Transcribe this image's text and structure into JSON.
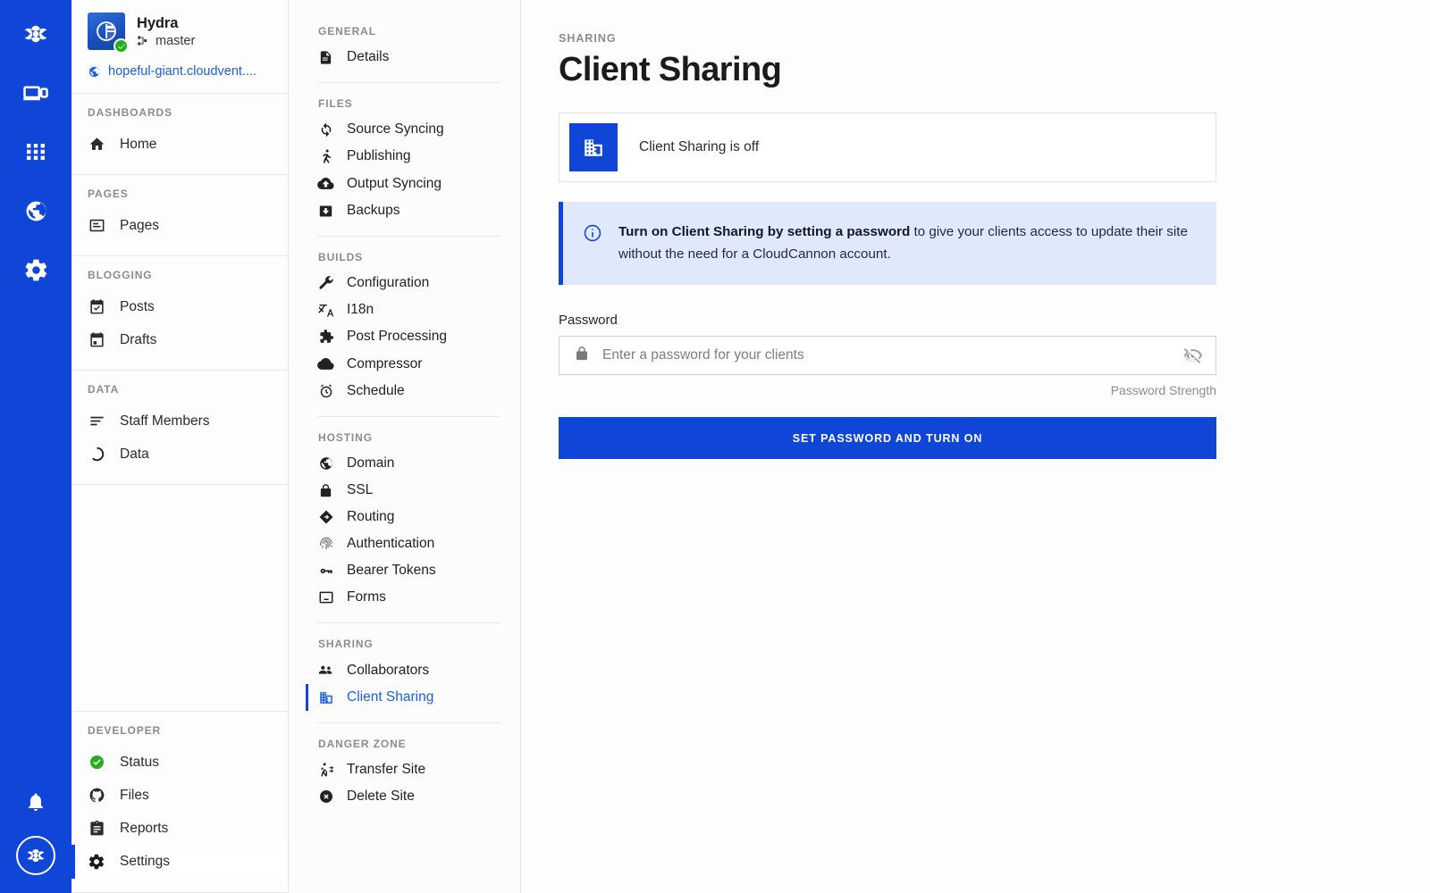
{
  "rail": {
    "top_icons": [
      {
        "name": "cloudcannon-logo-icon",
        "label": "CloudCannon"
      },
      {
        "name": "preview-device-icon",
        "label": "Preview"
      },
      {
        "name": "apps-grid-icon",
        "label": "Apps"
      },
      {
        "name": "globe-icon",
        "label": "Sites"
      },
      {
        "name": "gear-icon",
        "label": "Settings"
      }
    ],
    "bottom_icons": [
      {
        "name": "bell-icon",
        "label": "Notifications"
      },
      {
        "name": "user-avatar",
        "label": "Account"
      }
    ]
  },
  "sidebar": {
    "site_name": "Hydra",
    "branch": "master",
    "site_url": "hopeful-giant.cloudvent....",
    "groups": [
      {
        "title": "DASHBOARDS",
        "items": [
          {
            "label": "Home",
            "icon": "home-icon",
            "active": false
          }
        ]
      },
      {
        "title": "PAGES",
        "items": [
          {
            "label": "Pages",
            "icon": "page-icon",
            "active": false
          }
        ]
      },
      {
        "title": "BLOGGING",
        "items": [
          {
            "label": "Posts",
            "icon": "calendar-check-icon",
            "active": false
          },
          {
            "label": "Drafts",
            "icon": "calendar-draft-icon",
            "active": false
          }
        ]
      },
      {
        "title": "DATA",
        "items": [
          {
            "label": "Staff Members",
            "icon": "list-lines-icon",
            "active": false
          },
          {
            "label": "Data",
            "icon": "donut-icon",
            "active": false
          }
        ]
      }
    ],
    "developer": {
      "title": "DEVELOPER",
      "items": [
        {
          "label": "Status",
          "icon": "status-check-icon",
          "active": false
        },
        {
          "label": "Files",
          "icon": "github-icon",
          "active": false
        },
        {
          "label": "Reports",
          "icon": "clipboard-icon",
          "active": false
        },
        {
          "label": "Settings",
          "icon": "gear-icon",
          "active": true
        }
      ]
    }
  },
  "settings_nav": {
    "groups": [
      {
        "title": "GENERAL",
        "items": [
          {
            "label": "Details",
            "icon": "document-icon",
            "active": false
          }
        ]
      },
      {
        "title": "FILES",
        "items": [
          {
            "label": "Source Syncing",
            "icon": "sync-icon",
            "active": false
          },
          {
            "label": "Publishing",
            "icon": "publish-run-icon",
            "active": false
          },
          {
            "label": "Output Syncing",
            "icon": "cloud-upload-icon",
            "active": false
          },
          {
            "label": "Backups",
            "icon": "backup-icon",
            "active": false
          }
        ]
      },
      {
        "title": "BUILDS",
        "items": [
          {
            "label": "Configuration",
            "icon": "wrench-icon",
            "active": false
          },
          {
            "label": "I18n",
            "icon": "translate-icon",
            "active": false
          },
          {
            "label": "Post Processing",
            "icon": "puzzle-icon",
            "active": false
          },
          {
            "label": "Compressor",
            "icon": "cloud-icon",
            "active": false
          },
          {
            "label": "Schedule",
            "icon": "alarm-clock-icon",
            "active": false
          }
        ]
      },
      {
        "title": "HOSTING",
        "items": [
          {
            "label": "Domain",
            "icon": "globe-icon",
            "active": false
          },
          {
            "label": "SSL",
            "icon": "lock-icon",
            "active": false
          },
          {
            "label": "Routing",
            "icon": "routing-icon",
            "active": false
          },
          {
            "label": "Authentication",
            "icon": "fingerprint-icon",
            "active": false
          },
          {
            "label": "Bearer Tokens",
            "icon": "key-icon",
            "active": false
          },
          {
            "label": "Forms",
            "icon": "forms-inbox-icon",
            "active": false
          }
        ]
      },
      {
        "title": "SHARING",
        "items": [
          {
            "label": "Collaborators",
            "icon": "people-icon",
            "active": false
          },
          {
            "label": "Client Sharing",
            "icon": "building-icon",
            "active": true
          }
        ]
      },
      {
        "title": "DANGER ZONE",
        "items": [
          {
            "label": "Transfer Site",
            "icon": "transfer-walk-icon",
            "active": false
          },
          {
            "label": "Delete Site",
            "icon": "delete-circle-x-icon",
            "active": false
          }
        ]
      }
    ]
  },
  "main": {
    "eyebrow": "SHARING",
    "title": "Client Sharing",
    "status_card": {
      "icon": "building-icon",
      "text": "Client Sharing is off"
    },
    "info_banner": {
      "icon": "info-circle-icon",
      "bold_text": "Turn on Client Sharing by setting a password",
      "rest_text": " to give your clients access to update their site without the need for a CloudCannon account."
    },
    "password_field": {
      "label": "Password",
      "placeholder": "Enter a password for your clients",
      "value": "",
      "lock_icon": "lock-icon",
      "toggle_icon": "eye-off-icon",
      "strength_label": "Password Strength"
    },
    "submit_button": "SET PASSWORD AND TURN ON"
  },
  "colors": {
    "brand_blue": "#1046d8",
    "link_blue": "#1a5fe0",
    "banner_bg": "#dfe9fb",
    "status_green": "#27ae1e"
  }
}
